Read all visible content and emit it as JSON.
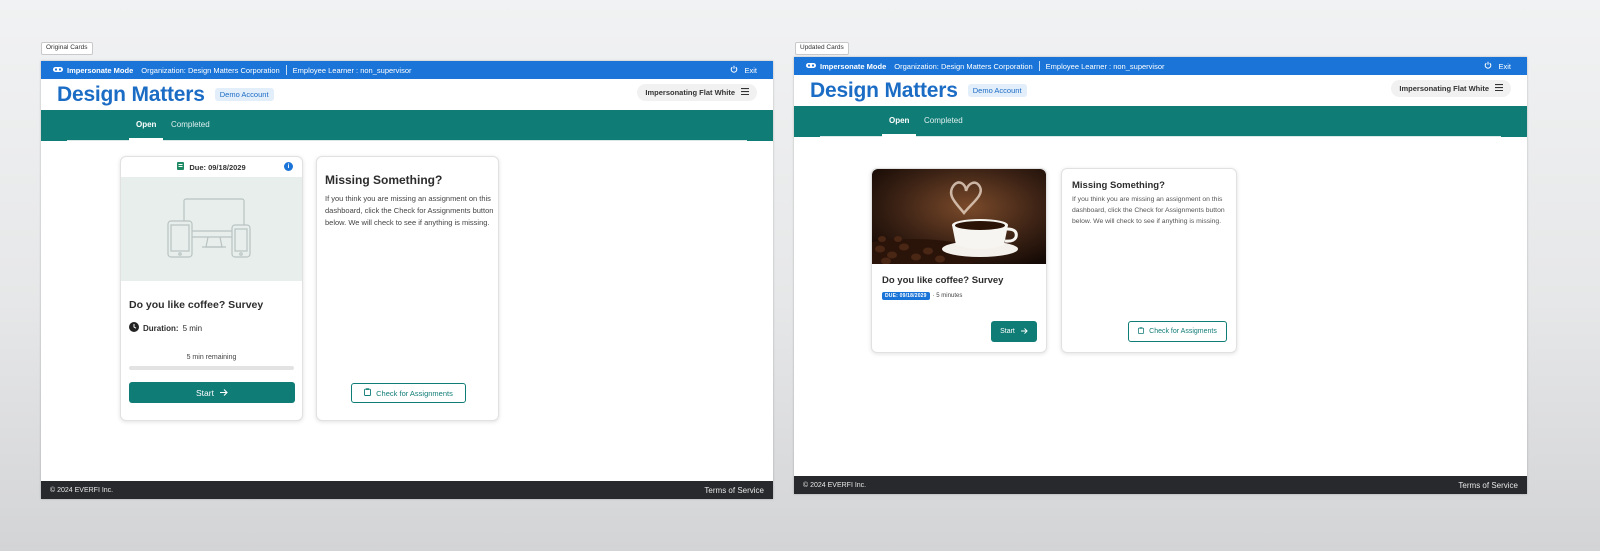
{
  "labels": {
    "original": "Original Cards",
    "updated": "Updated Cards"
  },
  "impersonation": {
    "mode": "Impersonate Mode",
    "organization": "Organization: Design Matters Corporation",
    "learner": "Employee Learner : non_supervisor",
    "exit": "Exit"
  },
  "header": {
    "brand": "Design Matters",
    "badge": "Demo Account",
    "impersonating": "Impersonating Flat White"
  },
  "tabs": [
    "Open",
    "Completed"
  ],
  "original_card": {
    "due": "Due: 09/18/2029",
    "title": "Do you like coffee? Survey",
    "duration_label": "Duration:",
    "duration_value": "5 min",
    "remaining": "5 min remaining",
    "progress": 0,
    "start": "Start"
  },
  "updated_card": {
    "title": "Do you like coffee? Survey",
    "due_badge": "DUE: 09/18/2029",
    "meta": "· 5 minutes",
    "start": "Start"
  },
  "missing_original": {
    "title": "Missing Something?",
    "body": "If you think you are missing an assignment on this dashboard, click the Check for Assignments button below. We will check to see if anything is missing.",
    "button": "Check for Assignments"
  },
  "missing_updated": {
    "title": "Missing Something?",
    "body": "If you think you are missing an assignment on this dashboard, click the Check for Assignments button below. We will check to see if anything is missing.",
    "button": "Check for Assigments"
  },
  "footer": {
    "copyright": "© 2024 EVERFI Inc.",
    "terms": "Terms of Service"
  },
  "colors": {
    "impersonate_bar": "#1b75d8",
    "brand": "#1b6cc4",
    "teal": "#107c76",
    "footer": "#27292c"
  }
}
